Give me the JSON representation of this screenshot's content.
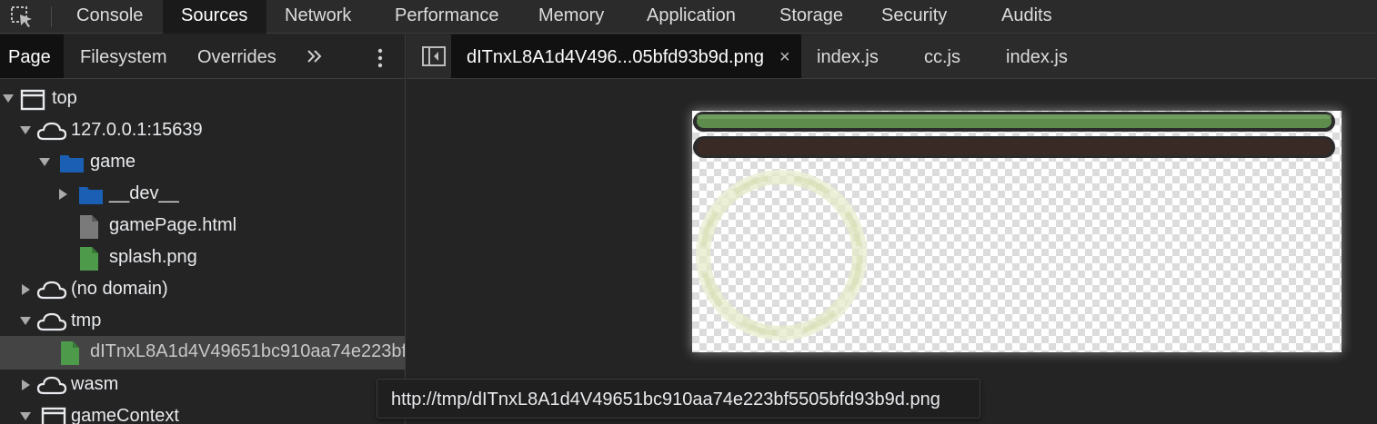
{
  "toolbar": {
    "tabs": [
      "Console",
      "Sources",
      "Network",
      "Performance",
      "Memory",
      "Application",
      "Storage",
      "Security",
      "Audits"
    ],
    "active_tab": "Sources"
  },
  "navigator": {
    "tabs": [
      "Page",
      "Filesystem",
      "Overrides"
    ],
    "active_tab": "Page",
    "more_icon": "double-chevron-icon",
    "menu_icon": "kebab-menu-icon",
    "tree": [
      {
        "label": "top",
        "icon": "frame-icon"
      },
      {
        "label": "127.0.0.1:15639",
        "icon": "cloud-icon"
      },
      {
        "label": "game",
        "icon": "folder-icon"
      },
      {
        "label": "__dev__",
        "icon": "folder-icon"
      },
      {
        "label": "gamePage.html",
        "icon": "file-icon"
      },
      {
        "label": "splash.png",
        "icon": "image-file-icon"
      },
      {
        "label": "(no domain)",
        "icon": "cloud-icon"
      },
      {
        "label": "tmp",
        "icon": "cloud-icon"
      },
      {
        "label": "dITnxL8A1d4V49651bc910aa74e223bf5505bfd93b9d.png",
        "icon": "image-file-icon",
        "selected": true
      },
      {
        "label": "wasm",
        "icon": "cloud-icon"
      },
      {
        "label": "gameContext",
        "icon": "frame-icon"
      }
    ]
  },
  "editor": {
    "tabs": [
      {
        "label": "dITnxL8A1d4V496...05bfd93b9d.png",
        "active": true,
        "closable": true
      },
      {
        "label": "index.js"
      },
      {
        "label": "cc.js"
      },
      {
        "label": "index.js"
      }
    ],
    "close_glyph": "×"
  },
  "tooltip": "http://tmp/dITnxL8A1d4V49651bc910aa74e223bf5505bfd93b9d.png",
  "colors": {
    "panel_bg": "#242424",
    "toolbar_bg": "#2b2b2b",
    "active_tab_bg": "#111111",
    "folder_blue": "#1a5fb4",
    "image_file_green": "#4e9a4b",
    "bar_green": "#5d8c4d",
    "bar_dark": "#3a2a26",
    "ring_cream": "#e6ebc9"
  }
}
